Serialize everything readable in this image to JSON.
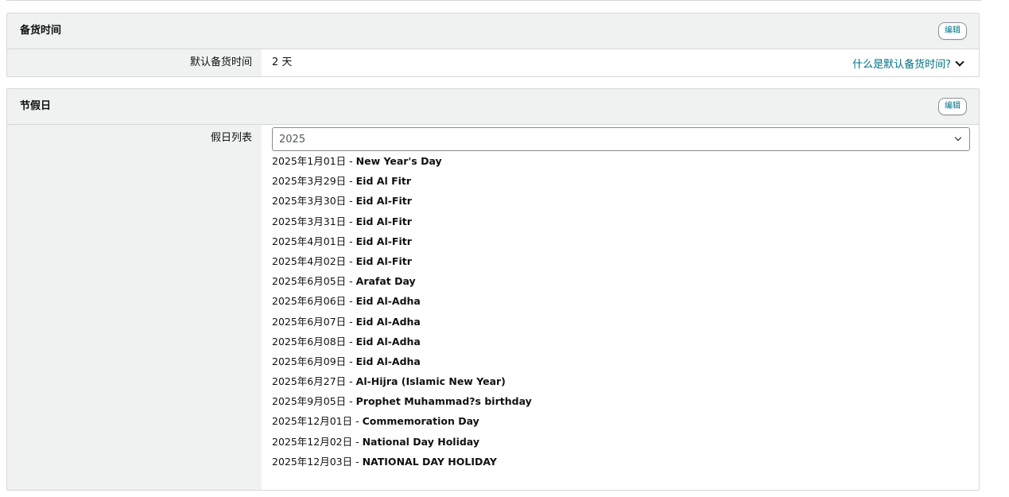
{
  "lead_time_section": {
    "title": "备货时间",
    "edit_label": "编辑",
    "row_label": "默认备货时间",
    "row_value": "2 天",
    "help_link": "什么是默认备货时间?"
  },
  "holiday_section": {
    "title": "节假日",
    "edit_label": "编辑",
    "row_label": "假日列表",
    "year_select": {
      "selected": "2025"
    },
    "separator": " - ",
    "holidays": [
      {
        "date": "2025年1月01日",
        "name": "New Year's Day"
      },
      {
        "date": "2025年3月29日",
        "name": "Eid Al Fitr"
      },
      {
        "date": "2025年3月30日",
        "name": "Eid Al-Fitr"
      },
      {
        "date": "2025年3月31日",
        "name": "Eid Al-Fitr"
      },
      {
        "date": "2025年4月01日",
        "name": "Eid Al-Fitr"
      },
      {
        "date": "2025年4月02日",
        "name": "Eid Al-Fitr"
      },
      {
        "date": "2025年6月05日",
        "name": "Arafat Day"
      },
      {
        "date": "2025年6月06日",
        "name": "Eid Al-Adha"
      },
      {
        "date": "2025年6月07日",
        "name": "Eid Al-Adha"
      },
      {
        "date": "2025年6月08日",
        "name": "Eid Al-Adha"
      },
      {
        "date": "2025年6月09日",
        "name": "Eid Al-Adha"
      },
      {
        "date": "2025年6月27日",
        "name": "Al-Hijra (Islamic New Year)"
      },
      {
        "date": "2025年9月05日",
        "name": "Prophet Muhammad?s birthday"
      },
      {
        "date": "2025年12月01日",
        "name": "Commemoration Day"
      },
      {
        "date": "2025年12月02日",
        "name": "National Day Holiday"
      },
      {
        "date": "2025年12月03日",
        "name": "NATIONAL DAY HOLIDAY"
      }
    ]
  },
  "colors": {
    "link": "#007185",
    "header_bg": "#f0f2f2",
    "border": "#d5d9d9",
    "text": "#0f1111"
  }
}
